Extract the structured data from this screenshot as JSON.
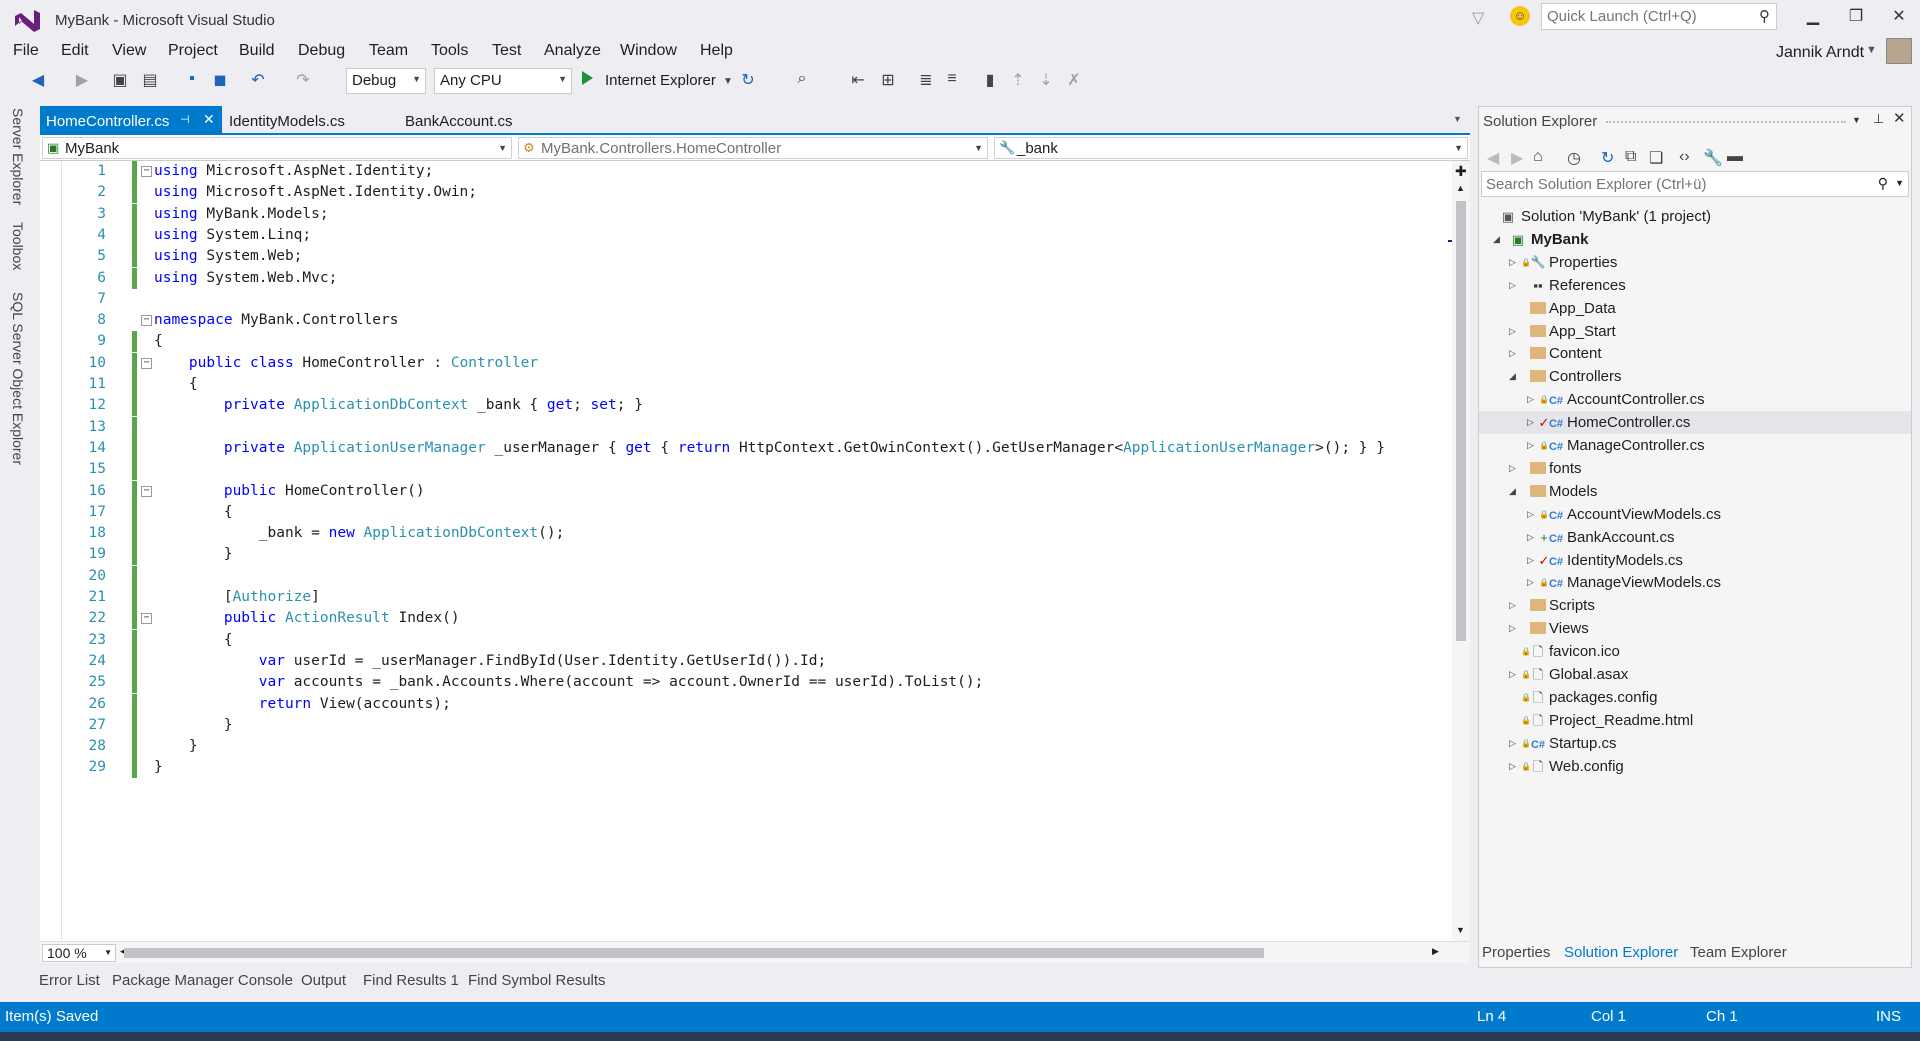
{
  "window": {
    "title": "MyBank - Microsoft Visual Studio",
    "quick_launch_placeholder": "Quick Launch (Ctrl+Q)",
    "user_name": "Jannik Arndt"
  },
  "menu": [
    "File",
    "Edit",
    "View",
    "Project",
    "Build",
    "Debug",
    "Team",
    "Tools",
    "Test",
    "Analyze",
    "Window",
    "Help"
  ],
  "toolbar": {
    "configuration": "Debug",
    "platform": "Any CPU",
    "run_target": "Internet Explorer"
  },
  "left_rail": [
    "Server Explorer",
    "Toolbox",
    "SQL Server Object Explorer"
  ],
  "doc_tabs": [
    "HomeController.cs",
    "IdentityModels.cs",
    "BankAccount.cs"
  ],
  "nav_bar": {
    "project": "MyBank",
    "type": "MyBank.Controllers.HomeController",
    "member": "_bank"
  },
  "code_lines": [
    "using Microsoft.AspNet.Identity;",
    "using Microsoft.AspNet.Identity.Owin;",
    "using MyBank.Models;",
    "using System.Linq;",
    "using System.Web;",
    "using System.Web.Mvc;",
    "",
    "namespace MyBank.Controllers",
    "{",
    "    public class HomeController : Controller",
    "    {",
    "        private ApplicationDbContext _bank { get; set; }",
    "",
    "        private ApplicationUserManager _userManager { get { return HttpContext.GetOwinContext().GetUserManager<ApplicationUserManager>(); } }",
    "",
    "        public HomeController()",
    "        {",
    "            _bank = new ApplicationDbContext();",
    "        }",
    "",
    "        [Authorize]",
    "        public ActionResult Index()",
    "        {",
    "            var userId = _userManager.FindById(User.Identity.GetUserId()).Id;",
    "            var accounts = _bank.Accounts.Where(account => account.OwnerId == userId).ToList();",
    "            return View(accounts);",
    "        }",
    "    }",
    "}"
  ],
  "zoom": "100 %",
  "bottom_tabs": [
    "Error List",
    "Package Manager Console",
    "Output",
    "Find Results 1",
    "Find Symbol Results"
  ],
  "status": {
    "message": "Item(s) Saved",
    "line": "Ln 4",
    "col": "Col 1",
    "ch": "Ch 1",
    "mode": "INS"
  },
  "solution_explorer": {
    "title": "Solution Explorer",
    "search_placeholder": "Search Solution Explorer (Ctrl+ü)",
    "solution": "Solution 'MyBank' (1 project)",
    "project": "MyBank",
    "items": [
      "Properties",
      "References",
      "App_Data",
      "App_Start",
      "Content",
      "Controllers",
      "AccountController.cs",
      "HomeController.cs",
      "ManageController.cs",
      "fonts",
      "Models",
      "AccountViewModels.cs",
      "BankAccount.cs",
      "IdentityModels.cs",
      "ManageViewModels.cs",
      "Scripts",
      "Views",
      "favicon.ico",
      "Global.asax",
      "packages.config",
      "Project_Readme.html",
      "Startup.cs",
      "Web.config"
    ],
    "bottom_tabs": [
      "Properties",
      "Solution Explorer",
      "Team Explorer"
    ]
  },
  "colors": {
    "accent": "#007acc",
    "keyword": "#0000ff",
    "type": "#2b91af",
    "changed": "#57a64a"
  }
}
